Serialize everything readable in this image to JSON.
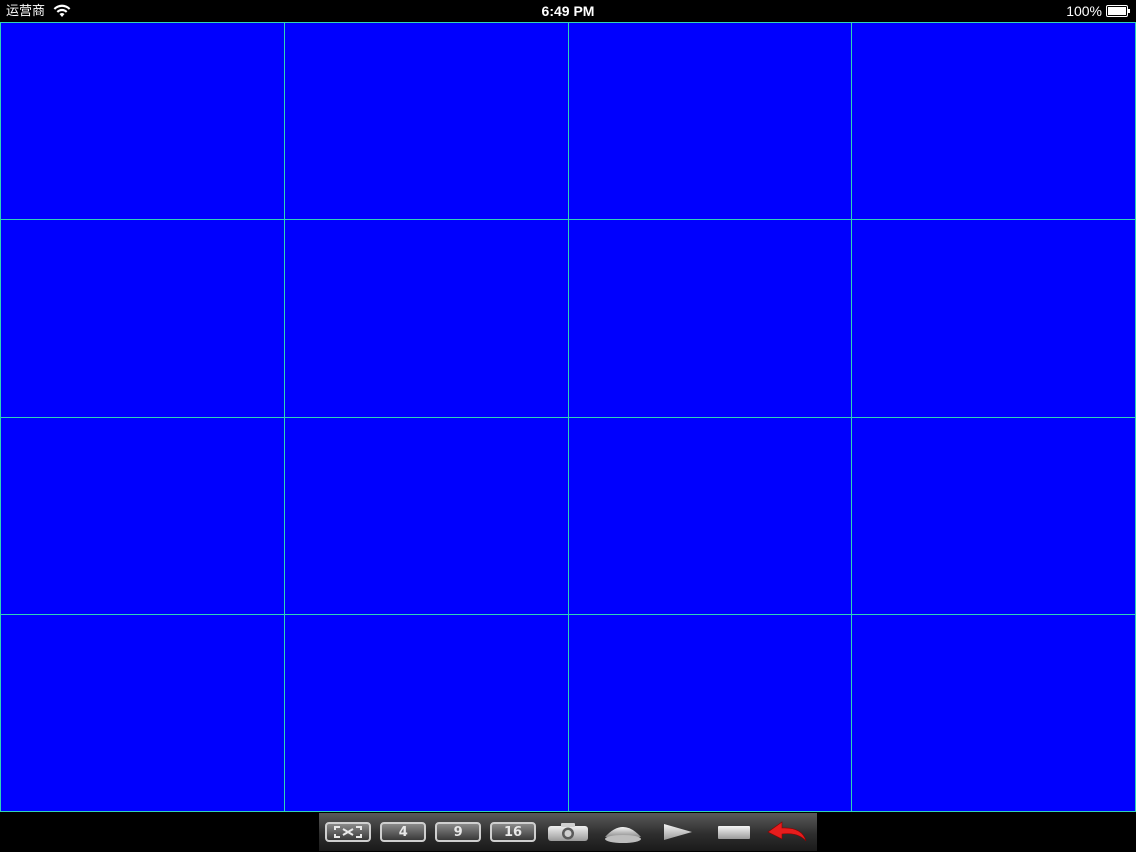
{
  "status_bar": {
    "carrier": "运营商",
    "time": "6:49 PM",
    "battery": "100%"
  },
  "video_grid": {
    "rows": 4,
    "columns": 4,
    "cell_color": "#0000fe",
    "border_color": "#2fd3b8"
  },
  "toolbar": {
    "buttons": [
      {
        "name": "fullscreen",
        "icon": "fullscreen-icon"
      },
      {
        "name": "layout-4",
        "label": "4"
      },
      {
        "name": "layout-9",
        "label": "9"
      },
      {
        "name": "layout-16",
        "label": "16"
      },
      {
        "name": "snapshot",
        "icon": "camera-icon"
      },
      {
        "name": "ptz",
        "icon": "dome-camera-icon"
      },
      {
        "name": "play",
        "icon": "play-icon"
      },
      {
        "name": "stop",
        "icon": "stop-icon"
      },
      {
        "name": "back",
        "icon": "back-arrow-icon"
      }
    ]
  }
}
